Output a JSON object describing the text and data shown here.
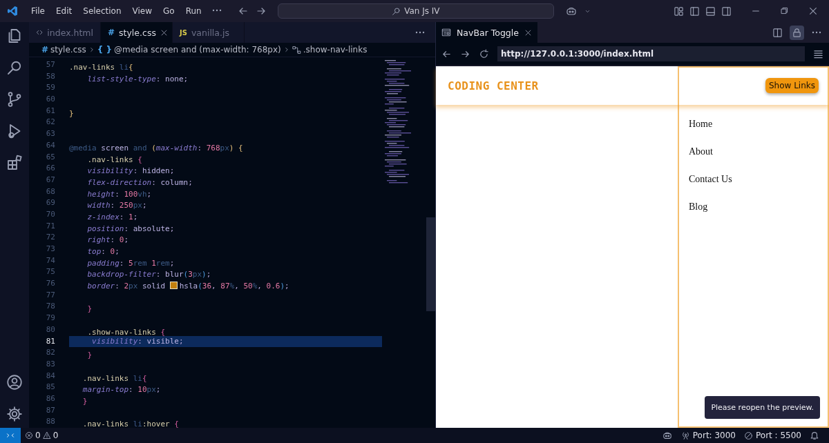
{
  "title_bar": {
    "menu": [
      "File",
      "Edit",
      "Selection",
      "View",
      "Go",
      "Run"
    ],
    "search": "Van Js IV"
  },
  "editor": {
    "tabs": [
      {
        "label": "index.html",
        "kind": "html",
        "selected": false
      },
      {
        "label": "style.css",
        "kind": "css",
        "badge": "#",
        "selected": true
      },
      {
        "label": "vanilla.js",
        "kind": "js",
        "badge": "JS",
        "selected": false
      }
    ],
    "breadcrumbs": [
      {
        "kind": "file",
        "badge": "#",
        "label": "style.css"
      },
      {
        "kind": "block",
        "badge": "{ }",
        "label": "@media screen and (max-width: 768px)"
      },
      {
        "kind": "selector",
        "label": ".show-nav-links"
      }
    ],
    "lines": [
      {
        "number": "57",
        "current": false,
        "tokens": [
          {
            "kind": "sel",
            "text": ".nav-links "
          },
          {
            "kind": "tag",
            "text": "li"
          },
          {
            "kind": "brace",
            "text": "{"
          }
        ]
      },
      {
        "number": "58",
        "current": false,
        "tokens": [
          {
            "kind": "prop",
            "text": "    list-style-type"
          },
          {
            "kind": "punc",
            "text": ": "
          },
          {
            "kind": "val",
            "text": "none"
          },
          {
            "kind": "punc",
            "text": ";"
          }
        ]
      },
      {
        "number": "59",
        "current": false
      },
      {
        "number": "60",
        "current": false
      },
      {
        "number": "61",
        "current": false,
        "tokens": [
          {
            "kind": "brace",
            "text": "}"
          }
        ]
      },
      {
        "number": "62",
        "current": false
      },
      {
        "number": "63",
        "current": false
      },
      {
        "number": "64",
        "current": false,
        "tokens": [
          {
            "kind": "at",
            "text": "@media"
          },
          {
            "kind": "val",
            "text": " screen "
          },
          {
            "kind": "at",
            "text": "and"
          },
          {
            "kind": "brace",
            "text": " ("
          },
          {
            "kind": "prop",
            "text": "max-width"
          },
          {
            "kind": "punc",
            "text": ": "
          },
          {
            "kind": "num",
            "text": "768"
          },
          {
            "kind": "unit",
            "text": "px"
          },
          {
            "kind": "brace",
            "text": ")"
          },
          {
            "kind": "brace",
            "text": " {"
          }
        ]
      },
      {
        "number": "65",
        "current": false,
        "tokens": [
          {
            "kind": "sel",
            "text": "    .nav-links "
          },
          {
            "kind": "brace2",
            "text": "{"
          }
        ]
      },
      {
        "number": "66",
        "current": false,
        "tokens": [
          {
            "kind": "prop",
            "text": "    visibility"
          },
          {
            "kind": "punc",
            "text": ": "
          },
          {
            "kind": "val",
            "text": "hidden"
          },
          {
            "kind": "punc",
            "text": ";"
          }
        ]
      },
      {
        "number": "67",
        "current": false,
        "tokens": [
          {
            "kind": "prop",
            "text": "    flex-direction"
          },
          {
            "kind": "punc",
            "text": ": "
          },
          {
            "kind": "val",
            "text": "column"
          },
          {
            "kind": "punc",
            "text": ";"
          }
        ]
      },
      {
        "number": "68",
        "current": false,
        "tokens": [
          {
            "kind": "prop",
            "text": "    height"
          },
          {
            "kind": "punc",
            "text": ": "
          },
          {
            "kind": "num",
            "text": "100"
          },
          {
            "kind": "unit",
            "text": "vh"
          },
          {
            "kind": "punc",
            "text": ";"
          }
        ]
      },
      {
        "number": "69",
        "current": false,
        "tokens": [
          {
            "kind": "prop",
            "text": "    width"
          },
          {
            "kind": "punc",
            "text": ": "
          },
          {
            "kind": "num",
            "text": "250"
          },
          {
            "kind": "unit",
            "text": "px"
          },
          {
            "kind": "punc",
            "text": ";"
          }
        ]
      },
      {
        "number": "70",
        "current": false,
        "tokens": [
          {
            "kind": "prop",
            "text": "    z-index"
          },
          {
            "kind": "punc",
            "text": ": "
          },
          {
            "kind": "num",
            "text": "1"
          },
          {
            "kind": "punc",
            "text": ";"
          }
        ]
      },
      {
        "number": "71",
        "current": false,
        "tokens": [
          {
            "kind": "prop",
            "text": "    position"
          },
          {
            "kind": "punc",
            "text": ": "
          },
          {
            "kind": "val",
            "text": "absolute"
          },
          {
            "kind": "punc",
            "text": ";"
          }
        ]
      },
      {
        "number": "72",
        "current": false,
        "tokens": [
          {
            "kind": "prop",
            "text": "    right"
          },
          {
            "kind": "punc",
            "text": ": "
          },
          {
            "kind": "num",
            "text": "0"
          },
          {
            "kind": "punc",
            "text": ";"
          }
        ]
      },
      {
        "number": "73",
        "current": false,
        "tokens": [
          {
            "kind": "prop",
            "text": "    top"
          },
          {
            "kind": "punc",
            "text": ": "
          },
          {
            "kind": "num",
            "text": "0"
          },
          {
            "kind": "punc",
            "text": ";"
          }
        ]
      },
      {
        "number": "74",
        "current": false,
        "tokens": [
          {
            "kind": "prop",
            "text": "    padding"
          },
          {
            "kind": "punc",
            "text": ": "
          },
          {
            "kind": "num",
            "text": "5"
          },
          {
            "kind": "unit",
            "text": "rem "
          },
          {
            "kind": "num",
            "text": "1"
          },
          {
            "kind": "unit",
            "text": "rem"
          },
          {
            "kind": "punc",
            "text": ";"
          }
        ]
      },
      {
        "number": "75",
        "current": false,
        "tokens": [
          {
            "kind": "prop",
            "text": "    backdrop-filter"
          },
          {
            "kind": "punc",
            "text": ": "
          },
          {
            "kind": "val",
            "text": "blur"
          },
          {
            "kind": "paren",
            "text": "("
          },
          {
            "kind": "num",
            "text": "3"
          },
          {
            "kind": "unit",
            "text": "px"
          },
          {
            "kind": "paren",
            "text": ")"
          },
          {
            "kind": "punc",
            "text": ";"
          }
        ]
      },
      {
        "number": "76",
        "current": false,
        "tokens": [
          {
            "kind": "prop",
            "text": "    border"
          },
          {
            "kind": "punc",
            "text": ": "
          },
          {
            "kind": "num",
            "text": "2"
          },
          {
            "kind": "unit",
            "text": "px "
          },
          {
            "kind": "val",
            "text": "solid "
          },
          {
            "kind": "swatch"
          },
          {
            "kind": "val",
            "text": "hsla"
          },
          {
            "kind": "paren",
            "text": "("
          },
          {
            "kind": "num",
            "text": "36"
          },
          {
            "kind": "punc",
            "text": ", "
          },
          {
            "kind": "num",
            "text": "87"
          },
          {
            "kind": "unit",
            "text": "%"
          },
          {
            "kind": "punc",
            "text": ", "
          },
          {
            "kind": "num",
            "text": "50"
          },
          {
            "kind": "unit",
            "text": "%"
          },
          {
            "kind": "punc",
            "text": ", "
          },
          {
            "kind": "num",
            "text": "0.6"
          },
          {
            "kind": "paren",
            "text": ")"
          },
          {
            "kind": "punc",
            "text": ";"
          }
        ]
      },
      {
        "number": "77",
        "current": false
      },
      {
        "number": "78",
        "current": false,
        "tokens": [
          {
            "kind": "brace2",
            "text": "    }"
          }
        ]
      },
      {
        "number": "79",
        "current": false
      },
      {
        "number": "80",
        "current": false,
        "tokens": [
          {
            "kind": "sel",
            "text": "    .show-nav-links "
          },
          {
            "kind": "brace2",
            "text": "{"
          }
        ]
      },
      {
        "number": "81",
        "current": true,
        "tokens": [
          {
            "kind": "prop",
            "text": "     visibility"
          },
          {
            "kind": "punc",
            "text": ": "
          },
          {
            "kind": "val",
            "text": "visible"
          },
          {
            "kind": "punc",
            "text": ";"
          }
        ]
      },
      {
        "number": "82",
        "current": false,
        "tokens": [
          {
            "kind": "brace2",
            "text": "    }"
          }
        ]
      },
      {
        "number": "83",
        "current": false
      },
      {
        "number": "84",
        "current": false,
        "tokens": [
          {
            "kind": "sel",
            "text": "   .nav-links "
          },
          {
            "kind": "tag",
            "text": "li"
          },
          {
            "kind": "brace2",
            "text": "{"
          }
        ]
      },
      {
        "number": "85",
        "current": false,
        "tokens": [
          {
            "kind": "prop",
            "text": "   margin-top"
          },
          {
            "kind": "punc",
            "text": ": "
          },
          {
            "kind": "num",
            "text": "10"
          },
          {
            "kind": "unit",
            "text": "px"
          },
          {
            "kind": "punc",
            "text": ";"
          }
        ]
      },
      {
        "number": "86",
        "current": false,
        "tokens": [
          {
            "kind": "brace2",
            "text": "   }"
          }
        ]
      },
      {
        "number": "87",
        "current": false
      },
      {
        "number": "88",
        "current": false,
        "tokens": [
          {
            "kind": "sel",
            "text": "   .nav-links "
          },
          {
            "kind": "tag",
            "text": "li"
          },
          {
            "kind": "sel",
            "text": ":hover "
          },
          {
            "kind": "brace2",
            "text": "{"
          }
        ]
      }
    ]
  },
  "preview": {
    "tab": "NavBar Toggle",
    "url": "http://127.0.0.1:3000/index.html",
    "page": {
      "brand": "CODING CENTER",
      "button": "Show Links",
      "links": [
        "Home",
        "About",
        "Contact Us",
        "Blog"
      ]
    },
    "tooltip": "Please reopen the preview."
  },
  "status_bar": {
    "errors": "0",
    "warnings": "0",
    "ports": [
      {
        "kind": "live",
        "label": "Port: 3000"
      },
      {
        "kind": "off",
        "label": "Port : 5500"
      }
    ]
  }
}
